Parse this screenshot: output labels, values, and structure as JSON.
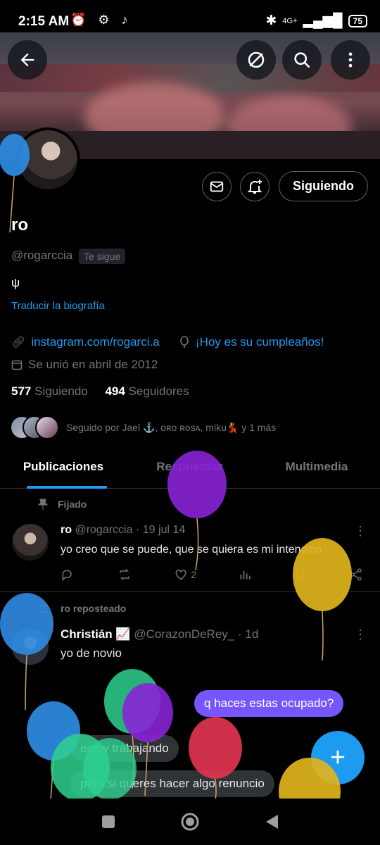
{
  "status_bar": {
    "time": "2:15 AM",
    "network": "4G+",
    "battery": "75"
  },
  "header": {
    "back_icon": "arrow-left-icon",
    "grok_icon": "slash-circle-icon",
    "search_icon": "search-icon",
    "more_icon": "more-vertical-icon"
  },
  "profile": {
    "name": "ro",
    "handle": "@rogarccia",
    "follows_you": "Te sigue",
    "bio": "ψ",
    "translate_bio": "Traducir la biografía",
    "website": "instagram.com/rogarci.a",
    "birthday": "¡Hoy es su cumpleaños!",
    "joined": "Se unió en abril de 2012",
    "following_count": "577",
    "following_label": "Siguiendo",
    "followers_count": "494",
    "followers_label": "Seguidores",
    "followed_by": "Seguido por Jael ⚓, ᴏʀᴏ ʀᴏsᴀ, miku💃 y 1 más",
    "follow_button": "Siguiendo"
  },
  "tabs": [
    {
      "label": "Publicaciones",
      "active": true
    },
    {
      "label": "Respuestas",
      "active": false
    },
    {
      "label": "Multimedia",
      "active": false
    }
  ],
  "tweets": [
    {
      "pinned_label": "Fijado",
      "author": "ro",
      "handle": "@rogarccia",
      "date": "· 19 jul 14",
      "text": "yo creo que se puede, que se quiera es mi intención",
      "likes": "2"
    },
    {
      "retweeted_label": "ro reposteado",
      "author": "Christián 📈",
      "handle": "@CorazonDeRey_",
      "date": "· 1d",
      "text": "yo de novio"
    }
  ],
  "dm_overlay": {
    "messages": [
      {
        "text": "q haces estas ocupado?",
        "from": "me"
      },
      {
        "text": "estoy trabajando",
        "from": "other"
      },
      {
        "text": "pero si queres hacer algo renuncio",
        "from": "other"
      }
    ]
  },
  "fab": {
    "label": "+"
  },
  "colors": {
    "accent": "#1d9bf0",
    "background": "#000000",
    "muted": "#71767b",
    "dm_bubble": "#7856ff"
  }
}
